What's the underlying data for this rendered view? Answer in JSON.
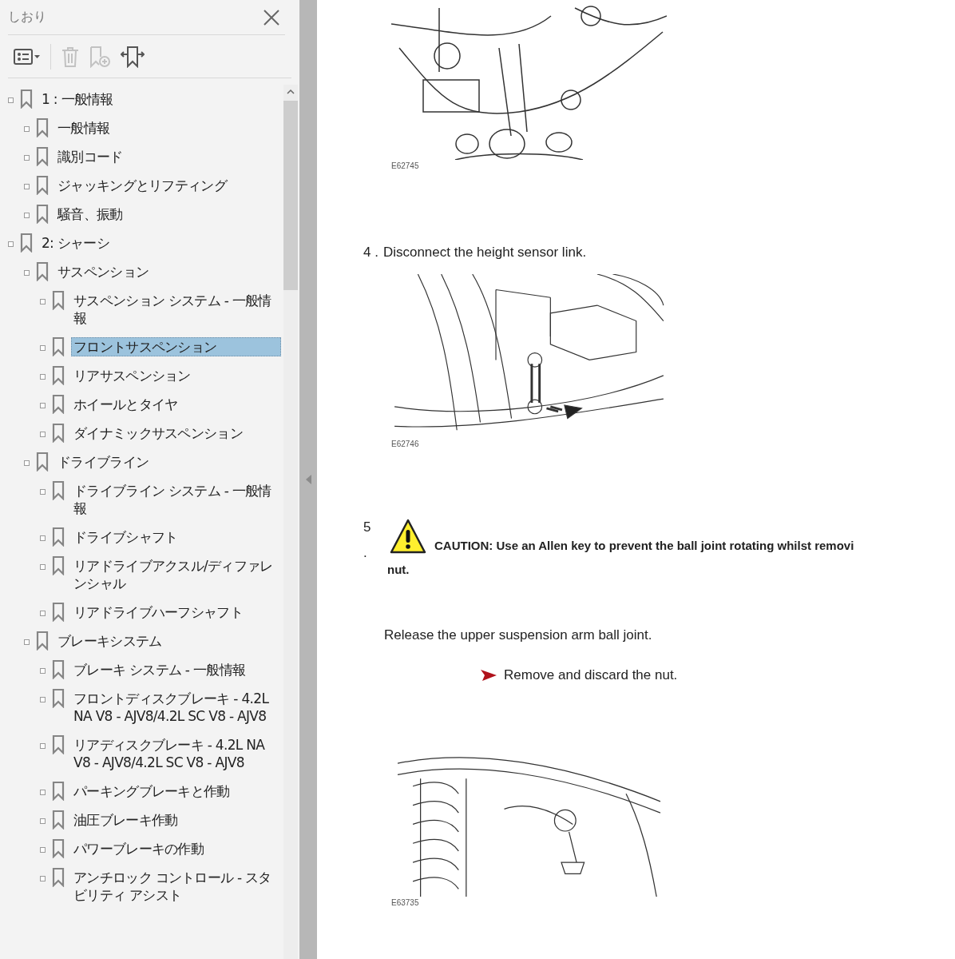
{
  "sidebar": {
    "title": "しおり",
    "toolbar": [
      {
        "kind": "list-options",
        "disabled": false
      },
      {
        "kind": "delete",
        "disabled": true
      },
      {
        "kind": "add-bookmark",
        "disabled": true
      },
      {
        "kind": "move-bookmark",
        "disabled": false
      }
    ],
    "tree": [
      {
        "label": "1 : 一般情報",
        "selected": false,
        "children": [
          {
            "label": "一般情報",
            "selected": false
          },
          {
            "label": "識別コード",
            "selected": false
          },
          {
            "label": "ジャッキングとリフティング",
            "selected": false
          },
          {
            "label": "騒音、振動",
            "selected": false
          }
        ]
      },
      {
        "label": "2: シャーシ",
        "selected": false,
        "children": [
          {
            "label": "サスペンション",
            "selected": false,
            "children": [
              {
                "label": "サスペンション システム - 一般情報",
                "selected": false
              },
              {
                "label": "フロントサスペンション",
                "selected": true
              },
              {
                "label": "リアサスペンション",
                "selected": false
              },
              {
                "label": "ホイールとタイヤ",
                "selected": false
              },
              {
                "label": "ダイナミックサスペンション",
                "selected": false
              }
            ]
          },
          {
            "label": "ドライブライン",
            "selected": false,
            "children": [
              {
                "label": "ドライブライン システム - 一般情報",
                "selected": false
              },
              {
                "label": "ドライブシャフト",
                "selected": false
              },
              {
                "label": "リアドライブアクスル/ディファレンシャル",
                "selected": false
              },
              {
                "label": "リアドライブハーフシャフト",
                "selected": false
              }
            ]
          },
          {
            "label": "ブレーキシステム",
            "selected": false,
            "children": [
              {
                "label": "ブレーキ システム - 一般情報",
                "selected": false
              },
              {
                "label": "フロントディスクブレーキ - 4.2L NA V8 - AJV8/4.2L SC V8 - AJV8",
                "selected": false
              },
              {
                "label": "リアディスクブレーキ - 4.2L NA V8 - AJV8/4.2L SC V8 - AJV8",
                "selected": false
              },
              {
                "label": "パーキングブレーキと作動",
                "selected": false
              },
              {
                "label": "油圧ブレーキ作動",
                "selected": false
              },
              {
                "label": "パワーブレーキの作動",
                "selected": false
              },
              {
                "label": "アンチロック コントロール - スタビリティ アシスト",
                "selected": false
              }
            ]
          }
        ]
      }
    ]
  },
  "document": {
    "blocks": [
      {
        "kind": "figure",
        "code": "E62745"
      },
      {
        "kind": "step",
        "number": "4 .",
        "text": "Disconnect the height sensor link."
      },
      {
        "kind": "figure",
        "code": "E62746"
      },
      {
        "kind": "caution",
        "number": "5",
        "dot": ".",
        "lines": [
          "CAUTION: Use an Allen key to prevent the ball joint rotating whilst removi",
          "nut."
        ]
      },
      {
        "kind": "paragraph",
        "text": "Release the upper suspension arm ball joint."
      },
      {
        "kind": "bullet",
        "text": "Remove and discard the nut."
      },
      {
        "kind": "figure",
        "code": "E63735"
      }
    ]
  }
}
